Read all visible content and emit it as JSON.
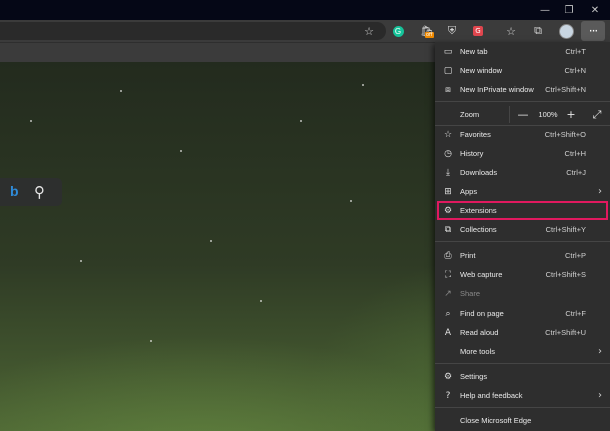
{
  "window": {
    "minimize_icon": "minimize-icon",
    "restore_icon": "restore-icon",
    "close_icon": "close-icon"
  },
  "toolbar": {
    "icons": [
      "add-to-favorites-icon",
      "grammarly-extension-icon",
      "coupon-extension-icon",
      "shield-extension-icon",
      "translate-extension-icon",
      "favorites-icon",
      "collections-icon",
      "profile-avatar-icon"
    ],
    "coupon_badge": "off",
    "more_label": "···"
  },
  "search": {
    "bing_label": "b",
    "search_icon": "search-icon"
  },
  "menu": {
    "items": [
      {
        "label": "New tab",
        "shortcut": "Ctrl+T",
        "icon": "new-tab-icon"
      },
      {
        "label": "New window",
        "shortcut": "Ctrl+N",
        "icon": "new-window-icon"
      },
      {
        "label": "New InPrivate window",
        "shortcut": "Ctrl+Shift+N",
        "icon": "inprivate-icon"
      },
      {
        "label": "Favorites",
        "shortcut": "Ctrl+Shift+O",
        "icon": "favorites-star-icon"
      },
      {
        "label": "History",
        "shortcut": "Ctrl+H",
        "icon": "history-icon"
      },
      {
        "label": "Downloads",
        "shortcut": "Ctrl+J",
        "icon": "download-icon"
      },
      {
        "label": "Apps",
        "shortcut": "",
        "icon": "apps-icon"
      },
      {
        "label": "Extensions",
        "shortcut": "",
        "icon": "puzzle-icon"
      },
      {
        "label": "Collections",
        "shortcut": "Ctrl+Shift+Y",
        "icon": "collections-icon"
      },
      {
        "label": "Print",
        "shortcut": "Ctrl+P",
        "icon": "printer-icon"
      },
      {
        "label": "Web capture",
        "shortcut": "Ctrl+Shift+S",
        "icon": "web-capture-icon"
      },
      {
        "label": "Share",
        "shortcut": "",
        "icon": "share-icon"
      },
      {
        "label": "Find on page",
        "shortcut": "Ctrl+F",
        "icon": "find-icon"
      },
      {
        "label": "Read aloud",
        "shortcut": "Ctrl+Shift+U",
        "icon": "read-aloud-icon"
      },
      {
        "label": "More tools",
        "shortcut": "",
        "icon": ""
      },
      {
        "label": "Settings",
        "shortcut": "",
        "icon": "gear-icon"
      },
      {
        "label": "Help and feedback",
        "shortcut": "",
        "icon": "help-icon"
      },
      {
        "label": "Close Microsoft Edge",
        "shortcut": "",
        "icon": ""
      }
    ],
    "zoom": {
      "label": "Zoom",
      "value": "100%",
      "minus": "—",
      "plus": "+"
    }
  },
  "colors": {
    "highlight": "#e0195f",
    "menu_bg": "#2e2e2e"
  }
}
